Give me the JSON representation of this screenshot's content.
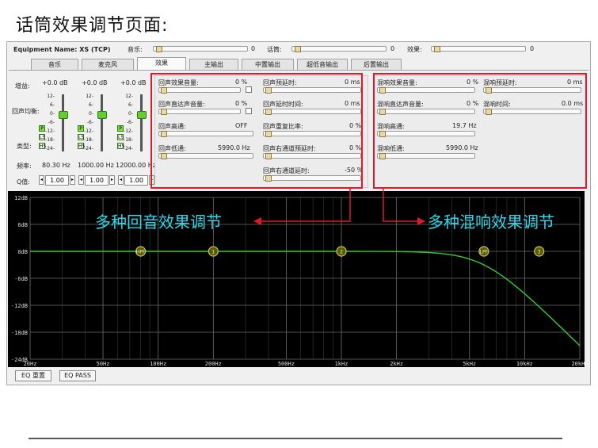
{
  "page_heading": "话筒效果调节页面:",
  "header": {
    "equipment": "Equipment Name: XS (TCP)",
    "music_label": "音乐:",
    "music_value": "0",
    "mic_label": "话筒:",
    "mic_value": "0",
    "effect_label": "效果:",
    "effect_value": "0"
  },
  "tabs": [
    {
      "label": "音乐"
    },
    {
      "label": "麦克风"
    },
    {
      "label": "效果",
      "active": true
    },
    {
      "label": "主输出"
    },
    {
      "label": "中置输出"
    },
    {
      "label": "超低音输出"
    },
    {
      "label": "后置输出"
    }
  ],
  "eq_controls": {
    "gain_label": "增益:",
    "balance_label": "回声均衡:",
    "type_label": "类型:",
    "freq_label": "频率:",
    "q_label": "Q值:",
    "ticks": [
      "12-",
      "6-",
      "0-",
      "-6-",
      "-12-",
      "-18-",
      "-24-"
    ],
    "badge_p": "P",
    "badge_ls": "LS",
    "badge_hs": "HS",
    "spin_left": "◂",
    "spin_right": "▸",
    "bands": [
      {
        "gain": "+0.0 dB",
        "freq": "80.30 Hz",
        "q": "1.00"
      },
      {
        "gain": "+0.0 dB",
        "freq": "1000.00 Hz",
        "q": "1.00"
      },
      {
        "gain": "+0.0 dB",
        "freq": "12000.00 Hz",
        "q": "1.00"
      }
    ]
  },
  "echo_params": {
    "col1": [
      {
        "label": "回声效果音量:",
        "value": "0 %"
      },
      {
        "label": "回声直达声音量:",
        "value": "0 %"
      },
      {
        "label": "回声高通:",
        "value": "OFF"
      },
      {
        "label": "回声低通:",
        "value": "5990.0 Hz"
      }
    ],
    "col2": [
      {
        "label": "回声预延时:",
        "value": "0 ms"
      },
      {
        "label": "回声延时时间:",
        "value": "0 ms"
      },
      {
        "label": "回声重复比率:",
        "value": "0 %"
      },
      {
        "label": "回声右通道预延时:",
        "value": "0 %"
      },
      {
        "label": "回声右通道延时:",
        "value": "-50 %"
      }
    ]
  },
  "reverb_params": {
    "col1": [
      {
        "label": "混响效果音量:",
        "value": "0 %"
      },
      {
        "label": "混响直达声音量:",
        "value": "0 %"
      },
      {
        "label": "混响高通:",
        "value": "19.7 Hz"
      },
      {
        "label": "混响低通:",
        "value": "5990.0 Hz"
      }
    ],
    "col2": [
      {
        "label": "混响预延时:",
        "value": "0 ms"
      },
      {
        "label": "混响时间:",
        "value": "0.0 ms"
      }
    ]
  },
  "annotations": {
    "echo": "多种回音效果调节",
    "reverb": "多种混响效果调节"
  },
  "eq_graph": {
    "db_labels": [
      "12dB",
      "6dB",
      "0dB",
      "-6dB",
      "-12dB",
      "-18dB",
      "-24dB"
    ],
    "freq_labels": [
      "20Hz",
      "50Hz",
      "100Hz",
      "200Hz",
      "500Hz",
      "1kHz",
      "2kHz",
      "5kHz",
      "10kHz",
      "20kHz"
    ],
    "nodes": [
      "HPF",
      "1",
      "2",
      "LPF",
      "3"
    ],
    "curve_color": "#33cc33"
  },
  "buttons": {
    "eq_reset": "EQ 重置",
    "eq_pass": "EQ PASS"
  },
  "colors": {
    "highlight": "#e0182a",
    "annotation": "#2fd7ea",
    "background": "#000000"
  }
}
